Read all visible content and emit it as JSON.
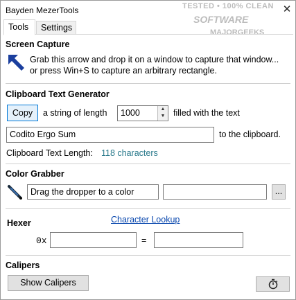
{
  "window": {
    "title": "Bayden MezerTools",
    "close_symbol": "✕"
  },
  "watermark": {
    "line1": "TESTED • 100% CLEAN",
    "line2": "SOFTWARE",
    "line3": "MAJORGEEKS"
  },
  "tabs": [
    {
      "label": "Tools",
      "selected": true
    },
    {
      "label": "Settings",
      "selected": false
    }
  ],
  "screen_capture": {
    "title": "Screen Capture",
    "description": "Grab this arrow and drop it on a window to capture that window... or press Win+S to capture an arbitrary rectangle.",
    "icon": "arrow-up-left-icon"
  },
  "clipboard": {
    "title": "Clipboard Text Generator",
    "copy_label": "Copy",
    "string_of_length_label": "a string of length",
    "length_value": "1000",
    "filled_with_label": "filled with the text",
    "text_value": "Codito Ergo Sum",
    "to_clipboard_label": "to the clipboard.",
    "length_label": "Clipboard Text Length:",
    "length_result": "118 characters"
  },
  "color_grabber": {
    "title": "Color Grabber",
    "icon": "dropper-icon",
    "dropper_text": "Drag the dropper to a color",
    "color_value": "",
    "more_label": "..."
  },
  "hexer": {
    "title": "Hexer",
    "character_lookup_link": "Character Lookup",
    "prefix": "0x",
    "hex_value": "",
    "equals": "=",
    "decimal_value": ""
  },
  "calipers": {
    "title": "Calipers",
    "show_label": "Show Calipers",
    "timer_icon": "stopwatch-icon"
  },
  "colors": {
    "accent": "#0078d7",
    "link": "#0645ad",
    "teal": "#2a7a8c",
    "arrow_blue": "#1b3f9e"
  }
}
